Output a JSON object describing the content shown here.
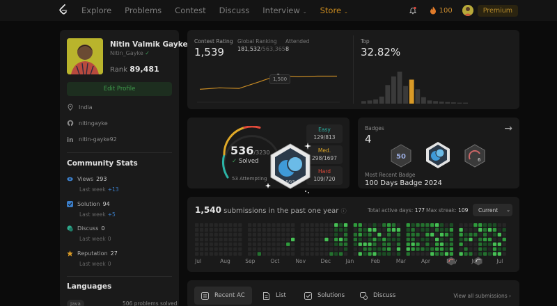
{
  "nav": {
    "links": [
      "Explore",
      "Problems",
      "Contest",
      "Discuss",
      "Interview",
      "Store"
    ],
    "streak_count": "100",
    "premium_label": "Premium"
  },
  "profile": {
    "name": "Nitin Valmik Gayke",
    "handle": "Nitin_Gayke",
    "rank_label": "Rank",
    "rank_value": "89,481",
    "edit_label": "Edit Profile",
    "location": "India",
    "github": "nitingayke",
    "linkedin": "nitin-gayke92"
  },
  "community": {
    "title": "Community Stats",
    "last_week_label": "Last week",
    "stats": [
      {
        "name": "Views",
        "value": "293",
        "delta": "+13",
        "color": "#3b7ec9"
      },
      {
        "name": "Solution",
        "value": "94",
        "delta": "+5",
        "color": "#3b7ec9"
      },
      {
        "name": "Discuss",
        "value": "0",
        "delta": "0",
        "color": "#2fa88b"
      },
      {
        "name": "Reputation",
        "value": "27",
        "delta": "0",
        "color": "#d99a26"
      }
    ]
  },
  "languages": {
    "title": "Languages",
    "tag": "Java",
    "value": "506 problems solved"
  },
  "contest": {
    "rating_label": "Contest Rating",
    "rating_value": "1,539",
    "global_label": "Global Ranking",
    "global_value": "181,532",
    "global_total": "/563,365",
    "attended_label": "Attended",
    "attended_value": "8",
    "tooltip": "1,500",
    "top_label": "Top",
    "top_value": "32.82%",
    "rating_series": [
      0.3,
      0.35,
      0.33,
      0.55,
      0.78,
      0.73,
      0.75,
      0.75
    ],
    "histogram": [
      0.08,
      0.1,
      0.13,
      0.22,
      0.58,
      0.85,
      1.0,
      0.55,
      0.75,
      0.45,
      0.2,
      0.1,
      0.08,
      0.06,
      0.05,
      0.04,
      0.03,
      0.03
    ],
    "highlight_index": 8
  },
  "solved": {
    "count": "536",
    "total": "/3230",
    "solved_label": "Solved",
    "attempting": "53 Attempting",
    "easy_label": "Easy",
    "easy_value": "129/813",
    "medium_label": "Med.",
    "medium_value": "298/1697",
    "hard_label": "Hard",
    "hard_value": "109/720",
    "badge_text": "DAYS"
  },
  "badges": {
    "title": "Badges",
    "count": "4",
    "recent_label": "Most Recent Badge",
    "recent_value": "100 Days Badge 2024",
    "mini_labels": [
      "50",
      "6"
    ]
  },
  "submissions": {
    "count": "1,540",
    "text": "submissions in the past one year",
    "active_label": "Total active days:",
    "active_value": "177",
    "streak_label": "Max streak:",
    "streak_value": "109",
    "dropdown": "Current",
    "months": [
      "Jul",
      "Aug",
      "Sep",
      "Oct",
      "Nov",
      "Dec",
      "Jan",
      "Feb",
      "Mar",
      "Apr",
      "May",
      "Jun",
      "Jul"
    ]
  },
  "tabs": {
    "items": [
      "Recent AC",
      "List",
      "Solutions",
      "Discuss"
    ],
    "view_all": "View all submissions"
  }
}
